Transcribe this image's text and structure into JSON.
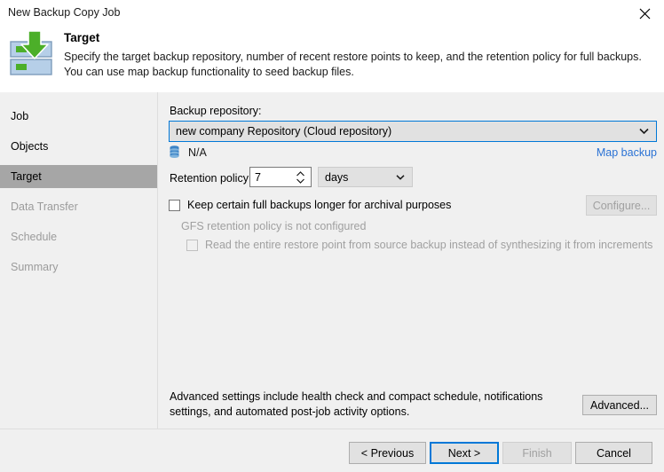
{
  "window": {
    "title": "New Backup Copy Job",
    "close_icon": "close-icon"
  },
  "header": {
    "icon": "backup-target-arrow-icon",
    "title": "Target",
    "description": "Specify the target backup repository, number of recent restore points to keep, and the retention policy for full backups. You can use map backup functionality to seed backup files."
  },
  "sidebar": {
    "items": [
      {
        "label": "Job",
        "state": "enabled"
      },
      {
        "label": "Objects",
        "state": "enabled"
      },
      {
        "label": "Target",
        "state": "selected"
      },
      {
        "label": "Data Transfer",
        "state": "disabled"
      },
      {
        "label": "Schedule",
        "state": "disabled"
      },
      {
        "label": "Summary",
        "state": "disabled"
      }
    ]
  },
  "main": {
    "backup_repository_label": "Backup repository:",
    "backup_repository_value": "new company Repository (Cloud repository)",
    "repository_icon": "repository-database-icon",
    "repository_capacity": "N/A",
    "map_backup_link": "Map backup",
    "retention_policy_label": "Retention policy:",
    "retention_value": "7",
    "retention_unit": "days",
    "gfs_checkbox_label": "Keep certain full backups longer for archival purposes",
    "gfs_checkbox_checked": false,
    "gfs_status_text": "GFS retention policy is not configured",
    "read_entire_checkbox_label": "Read the entire restore point from source backup instead of synthesizing it from increments",
    "read_entire_checkbox_checked": false,
    "configure_button": "Configure...",
    "advanced_note": "Advanced settings include health check and compact schedule, notifications settings, and automated post-job activity options.",
    "advanced_button": "Advanced..."
  },
  "footer": {
    "previous_button": "< Previous",
    "next_button": "Next >",
    "finish_button": "Finish",
    "cancel_button": "Cancel"
  },
  "colors": {
    "accent": "#0078d7",
    "link": "#2a72d4",
    "selected_nav": "#a6a6a6",
    "panel": "#f0f0f0",
    "icon_green": "#4caf29",
    "icon_blue": "#b6cfe8",
    "repo_icon_blue": "#3d84c6"
  }
}
